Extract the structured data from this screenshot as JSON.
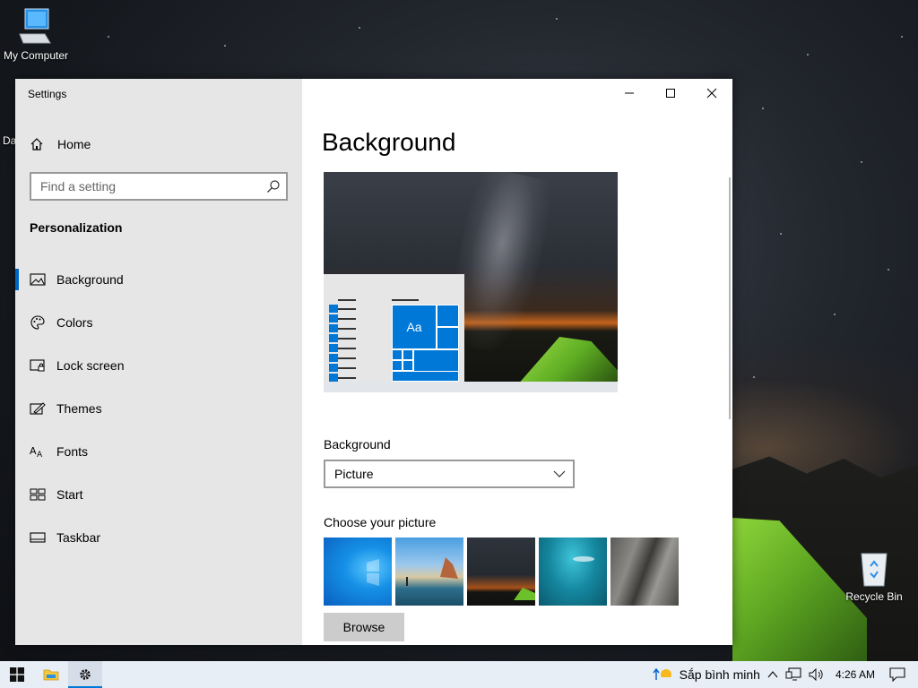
{
  "desktop": {
    "icons": [
      {
        "label": "My Computer"
      },
      {
        "label": "Recycle Bin"
      },
      {
        "label": "Da"
      }
    ]
  },
  "window": {
    "title": "Settings",
    "sidebar": {
      "home_label": "Home",
      "search_placeholder": "Find a setting",
      "section_heading": "Personalization",
      "items": [
        {
          "label": "Background",
          "icon": "picture-icon",
          "active": true
        },
        {
          "label": "Colors",
          "icon": "palette-icon",
          "active": false
        },
        {
          "label": "Lock screen",
          "icon": "lock-screen-icon",
          "active": false
        },
        {
          "label": "Themes",
          "icon": "themes-brush-icon",
          "active": false
        },
        {
          "label": "Fonts",
          "icon": "fonts-icon",
          "active": false
        },
        {
          "label": "Start",
          "icon": "start-tiles-icon",
          "active": false
        },
        {
          "label": "Taskbar",
          "icon": "taskbar-icon",
          "active": false
        }
      ]
    },
    "content": {
      "title": "Background",
      "preview_tile_text": "Aa",
      "background_label": "Background",
      "background_value": "Picture",
      "choose_label": "Choose your picture",
      "thumbnails": [
        "windows-logo-wallpaper",
        "beach-rocks-wallpaper",
        "night-sky-tent-wallpaper",
        "underwater-swimmer-wallpaper",
        "rock-cliff-wallpaper"
      ],
      "browse_label": "Browse"
    }
  },
  "taskbar": {
    "weather_text": "Sắp bình minh",
    "time": "4:26 AM"
  },
  "colors": {
    "accent": "#0078d7",
    "sidebar_bg": "#e6e6e6",
    "taskbar_bg": "#e8eef5"
  }
}
